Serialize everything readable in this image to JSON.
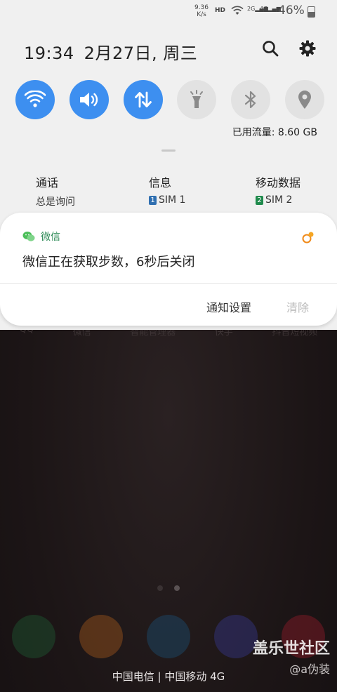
{
  "status_bar": {
    "net_speed_value": "9.36",
    "net_speed_unit": "K/s",
    "hd_label": "HD",
    "sig1_label": "2G",
    "sig2_label": "4G",
    "battery_percent": "46%"
  },
  "header": {
    "time": "19:34",
    "date": "2月27日, 周三",
    "search_icon": "search-icon",
    "settings_icon": "gear-icon"
  },
  "quick_tiles": [
    {
      "name": "wifi",
      "icon": "wifi-icon",
      "state": "on"
    },
    {
      "name": "sound",
      "icon": "volume-icon",
      "state": "on"
    },
    {
      "name": "mobile-data",
      "icon": "data-transfer-icon",
      "state": "on"
    },
    {
      "name": "flashlight",
      "icon": "flashlight-icon",
      "state": "off"
    },
    {
      "name": "bluetooth",
      "icon": "bluetooth-icon",
      "state": "off"
    },
    {
      "name": "location",
      "icon": "location-icon",
      "state": "off"
    }
  ],
  "data_usage": "已用流量: 8.60 GB",
  "sim_settings": {
    "call": {
      "title": "通话",
      "value": "总是询问"
    },
    "message": {
      "title": "信息",
      "sim_number": "1",
      "value": "SIM 1"
    },
    "mobile_data": {
      "title": "移动数据",
      "sim_number": "2",
      "value": "SIM 2"
    }
  },
  "notification": {
    "app_name": "微信",
    "message": "微信正在获取步数，6秒后关闭",
    "action_settings": "通知设置",
    "action_clear": "清除"
  },
  "home_apps": [
    "QQ",
    "微信",
    "智能管理器",
    "快手",
    "抖音短视频"
  ],
  "carrier_text": "中国电信 | 中国移动 4G",
  "watermark": "盖乐世社区",
  "watermark_user": "@a伪装",
  "colors": {
    "accent": "#3d8ff0",
    "sim1": "#2f6fb0",
    "sim2": "#1f8a4c",
    "wechat_green": "#2e8b57"
  }
}
